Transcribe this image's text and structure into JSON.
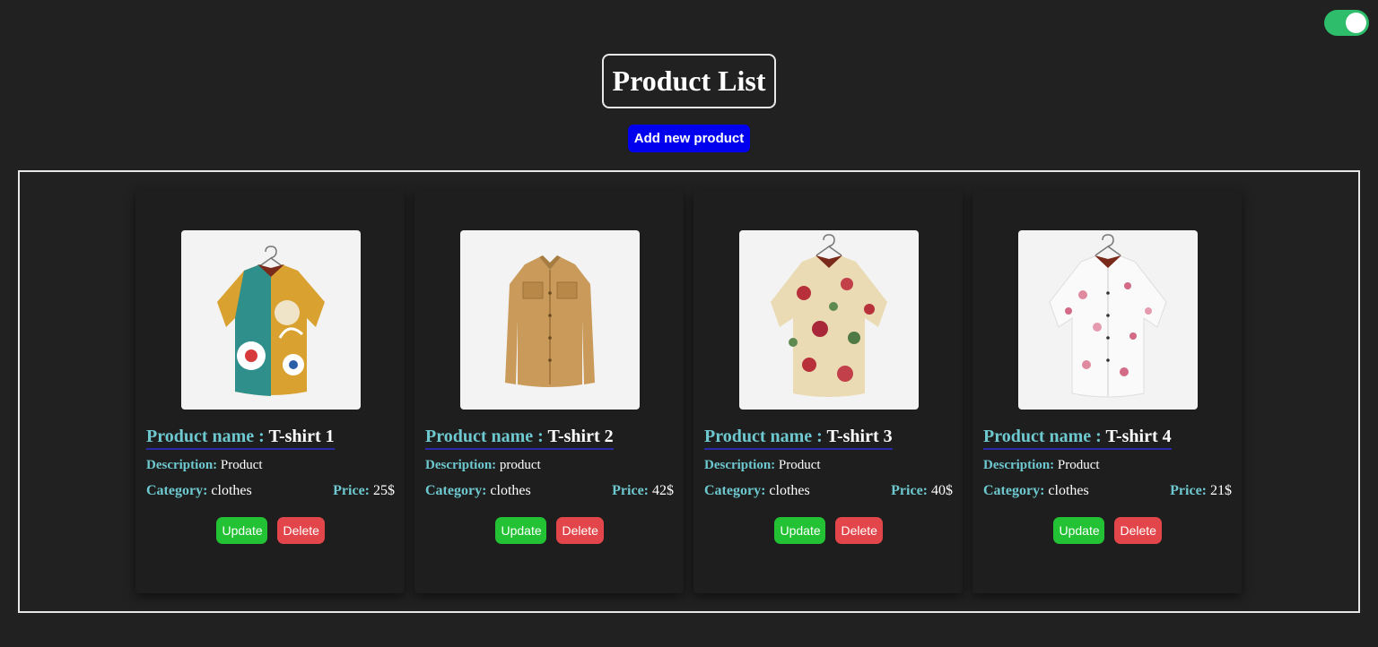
{
  "header": {
    "title": "Product List",
    "add_button_label": "Add new product"
  },
  "theme_toggle": {
    "state": "on",
    "color": "#2ebd6b"
  },
  "labels": {
    "product_name": "Product name : ",
    "description": "Description: ",
    "category": "Category: ",
    "price": "Price: ",
    "update": "Update",
    "delete": "Delete"
  },
  "products": [
    {
      "name": "T-shirt 1",
      "description": "Product",
      "category": "clothes",
      "price": "25$",
      "image_icon": "floral-print-shirt-icon"
    },
    {
      "name": "T-shirt 2",
      "description": "product",
      "category": "clothes",
      "price": "42$",
      "image_icon": "tan-button-shirt-icon"
    },
    {
      "name": "T-shirt 3",
      "description": "Product",
      "category": "clothes",
      "price": "40$",
      "image_icon": "floral-print-shirt-icon"
    },
    {
      "name": "T-shirt 4",
      "description": "Product",
      "category": "clothes",
      "price": "21$",
      "image_icon": "floral-print-shirt-icon"
    }
  ],
  "colors": {
    "background": "#212121",
    "accent_label": "#6ec8cf",
    "add_button": "#0000ee",
    "update_button": "#22c234",
    "delete_button": "#e2464a"
  }
}
